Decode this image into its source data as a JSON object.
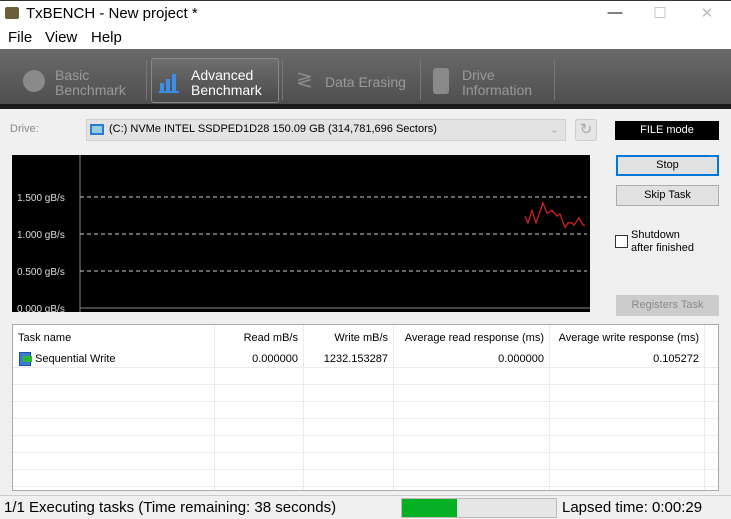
{
  "window": {
    "title": "TxBENCH - New project *",
    "minimize": "—",
    "maximize": "☐",
    "close": "✕"
  },
  "menu": [
    "File",
    "View",
    "Help"
  ],
  "tabs": [
    {
      "line1": "Basic",
      "line2": "Benchmark",
      "icon": "stopwatch-icon",
      "active": false
    },
    {
      "line1": "Advanced",
      "line2": "Benchmark",
      "icon": "bar-chart-icon",
      "active": true
    },
    {
      "line1": "Data Erasing",
      "line2": "",
      "icon": "eraser-icon",
      "active": false
    },
    {
      "line1": "Drive",
      "line2": "Information",
      "icon": "drive-info-icon",
      "active": false
    }
  ],
  "drive": {
    "label": "Drive:",
    "value": "(C:) NVMe INTEL SSDPED1D28  150.09 GB (314,781,696 Sectors)",
    "mode": "FILE mode"
  },
  "buttons": {
    "stop": "Stop",
    "skip": "Skip Task",
    "registers": "Registers Task"
  },
  "shutdown": {
    "line1": "Shutdown",
    "line2": "after finished",
    "checked": false
  },
  "chart_data": {
    "type": "line",
    "ylabel": "",
    "yticks": [
      "0.000 gB/s",
      "0.500 gB/s",
      "1.000 gB/s",
      "1.500 gB/s"
    ],
    "ylim": [
      0,
      2.0
    ],
    "grid": "dashed horizontal",
    "series": [
      {
        "color": "#e0202a",
        "values": [
          1.24,
          1.15,
          1.32,
          1.15,
          1.42,
          1.28,
          1.32,
          1.24,
          1.27,
          1.09,
          1.15,
          1.15,
          1.12,
          1.22,
          1.12,
          1.12
        ]
      }
    ]
  },
  "table": {
    "columns": [
      "Task name",
      "Read mB/s",
      "Write mB/s",
      "Average read response (ms)",
      "Average write response (ms)"
    ],
    "rows": [
      [
        "Sequential Write",
        "0.000000",
        "1232.153287",
        "0.000000",
        "0.105272"
      ]
    ]
  },
  "status": {
    "text": "1/1 Executing tasks (Time remaining: 38 seconds)",
    "progress_percent": 36,
    "progress_color": "#06b025",
    "lapsed": "Lapsed time: 0:00:29"
  }
}
